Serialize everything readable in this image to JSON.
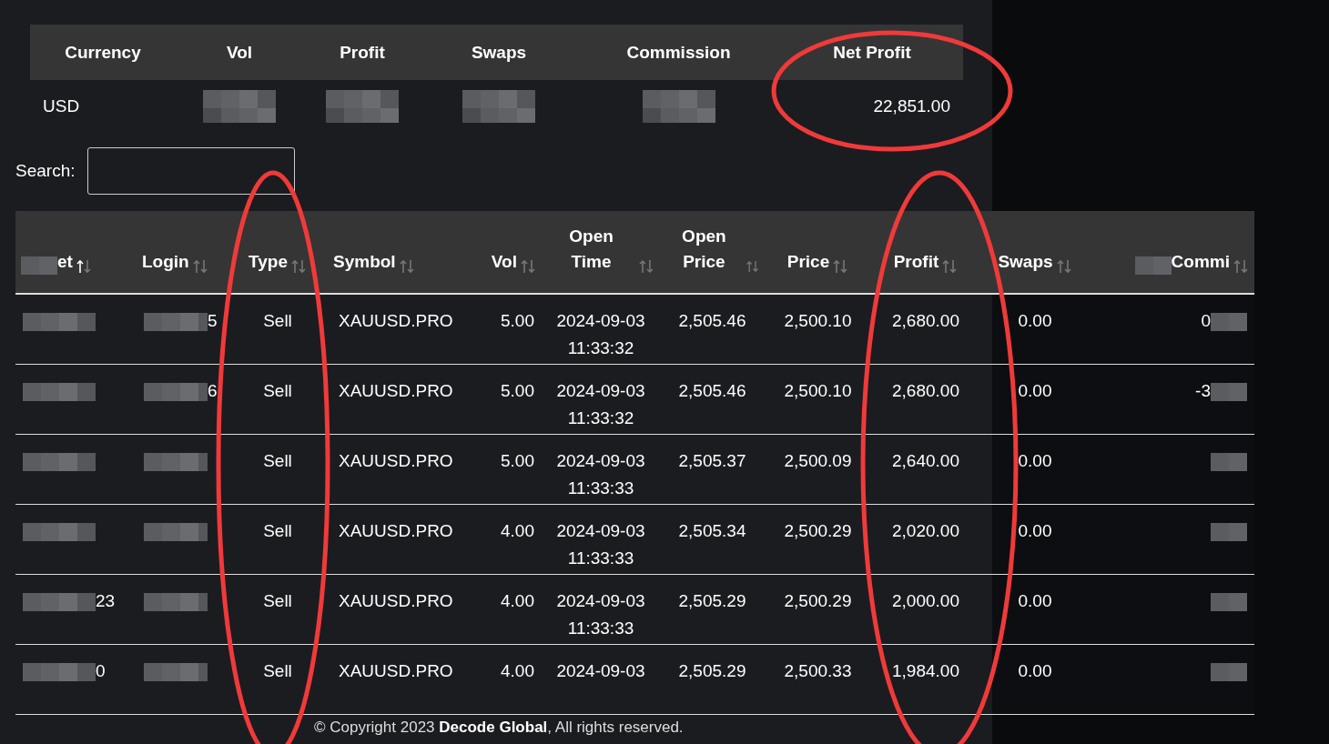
{
  "summary": {
    "columns": [
      "Currency",
      "Vol",
      "Profit",
      "Swaps",
      "Commission",
      "Net Profit"
    ],
    "row": [
      {
        "kind": "text",
        "text": "USD"
      },
      {
        "kind": "redacted"
      },
      {
        "kind": "redacted"
      },
      {
        "kind": "redacted"
      },
      {
        "kind": "redacted"
      },
      {
        "kind": "text",
        "text": "22,851.00"
      }
    ]
  },
  "search": {
    "label": "Search:"
  },
  "table": {
    "columns": [
      {
        "label": "et",
        "sorted": true,
        "redacted": true
      },
      {
        "label": "Login",
        "sorted": false,
        "redacted": false
      },
      {
        "label": "Type",
        "sorted": false,
        "redacted": false
      },
      {
        "label": "Symbol",
        "sorted": false,
        "redacted": false
      },
      {
        "label": "Vol",
        "sorted": false,
        "redacted": false
      },
      {
        "label": "Open Time",
        "sorted": false,
        "redacted": false
      },
      {
        "label": "Open Price",
        "sorted": false,
        "redacted": false
      },
      {
        "label": "Price",
        "sorted": false,
        "redacted": false
      },
      {
        "label": "Profit",
        "sorted": false,
        "redacted": false
      },
      {
        "label": "Swaps",
        "sorted": false,
        "redacted": false
      },
      {
        "label": "Commi",
        "sorted": false,
        "redacted": true
      }
    ],
    "rows": [
      {
        "ticket": "",
        "login": "5",
        "type": "Sell",
        "symbol": "XAUUSD.PRO",
        "vol": "5.00",
        "open_time": "2024-09-03 11:33:32",
        "open_price": "2,505.46",
        "price": "2,500.10",
        "profit": "2,680.00",
        "swaps": "0.00",
        "commission": "0"
      },
      {
        "ticket": "",
        "login": "6",
        "type": "Sell",
        "symbol": "XAUUSD.PRO",
        "vol": "5.00",
        "open_time": "2024-09-03 11:33:32",
        "open_price": "2,505.46",
        "price": "2,500.10",
        "profit": "2,680.00",
        "swaps": "0.00",
        "commission": "-3"
      },
      {
        "ticket": "",
        "login": "",
        "type": "Sell",
        "symbol": "XAUUSD.PRO",
        "vol": "5.00",
        "open_time": "2024-09-03 11:33:33",
        "open_price": "2,505.37",
        "price": "2,500.09",
        "profit": "2,640.00",
        "swaps": "0.00",
        "commission": ""
      },
      {
        "ticket": "",
        "login": "",
        "type": "Sell",
        "symbol": "XAUUSD.PRO",
        "vol": "4.00",
        "open_time": "2024-09-03 11:33:33",
        "open_price": "2,505.34",
        "price": "2,500.29",
        "profit": "2,020.00",
        "swaps": "0.00",
        "commission": ""
      },
      {
        "ticket": "23",
        "login": "",
        "type": "Sell",
        "symbol": "XAUUSD.PRO",
        "vol": "4.00",
        "open_time": "2024-09-03 11:33:33",
        "open_price": "2,505.29",
        "price": "2,500.29",
        "profit": "2,000.00",
        "swaps": "0.00",
        "commission": ""
      },
      {
        "ticket": "0",
        "login": "",
        "type": "Sell",
        "symbol": "XAUUSD.PRO",
        "vol": "4.00",
        "open_time": "2024-09-03",
        "open_price": "2,505.29",
        "price": "2,500.33",
        "profit": "1,984.00",
        "swaps": "0.00",
        "commission": ""
      }
    ]
  },
  "footer": "© Copyright 2023 **Decode Global**, All rights reserved.",
  "annotations": [
    {
      "kind": "ellipse"
    },
    {
      "kind": "ellipse"
    },
    {
      "kind": "ellipse"
    }
  ]
}
